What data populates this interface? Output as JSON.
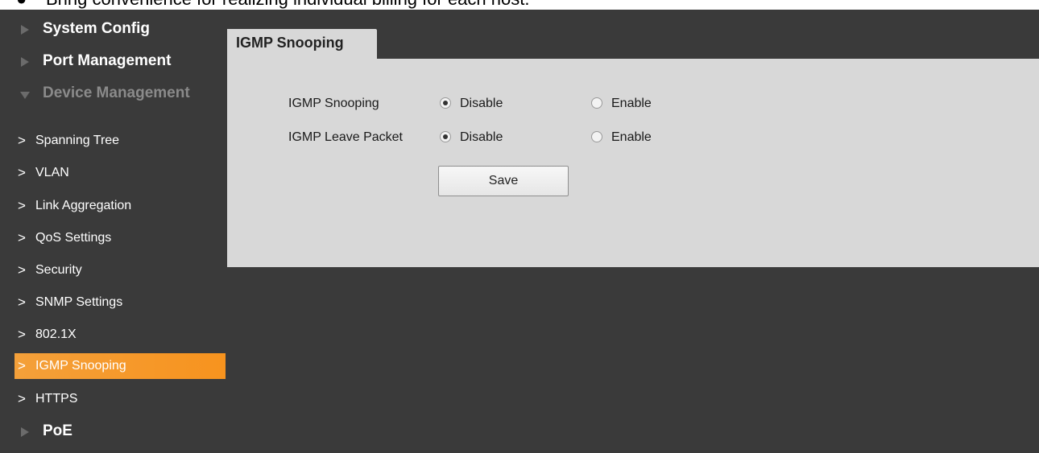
{
  "doc": {
    "bullet": "●",
    "caption": "Bring convenience for realizing individual billing for each host."
  },
  "sidebar": {
    "top_items": [
      {
        "label": "System Config",
        "expanded": false
      },
      {
        "label": "Port Management",
        "expanded": false
      },
      {
        "label": "Device Management",
        "expanded": true
      },
      {
        "label": "PoE",
        "expanded": false
      }
    ],
    "chevron": ">",
    "sub_items": [
      {
        "label": "Spanning Tree",
        "active": false
      },
      {
        "label": "VLAN",
        "active": false
      },
      {
        "label": "Link Aggregation",
        "active": false
      },
      {
        "label": "QoS Settings",
        "active": false
      },
      {
        "label": "Security",
        "active": false
      },
      {
        "label": "SNMP Settings",
        "active": false
      },
      {
        "label": "802.1X",
        "active": false
      },
      {
        "label": "IGMP Snooping",
        "active": true
      },
      {
        "label": "HTTPS",
        "active": false
      }
    ]
  },
  "main": {
    "tab_label": "IGMP Snooping",
    "rows": [
      {
        "label": "IGMP Snooping",
        "options": [
          {
            "label": "Disable",
            "checked": true
          },
          {
            "label": "Enable",
            "checked": false
          }
        ]
      },
      {
        "label": "IGMP Leave Packet",
        "options": [
          {
            "label": "Disable",
            "checked": true
          },
          {
            "label": "Enable",
            "checked": false
          }
        ]
      }
    ],
    "save_label": "Save"
  },
  "colors": {
    "background": "#3a3a3a",
    "panel": "#d8d8d8",
    "active_item": "#f7931e",
    "muted_text": "#8a8a8a"
  }
}
